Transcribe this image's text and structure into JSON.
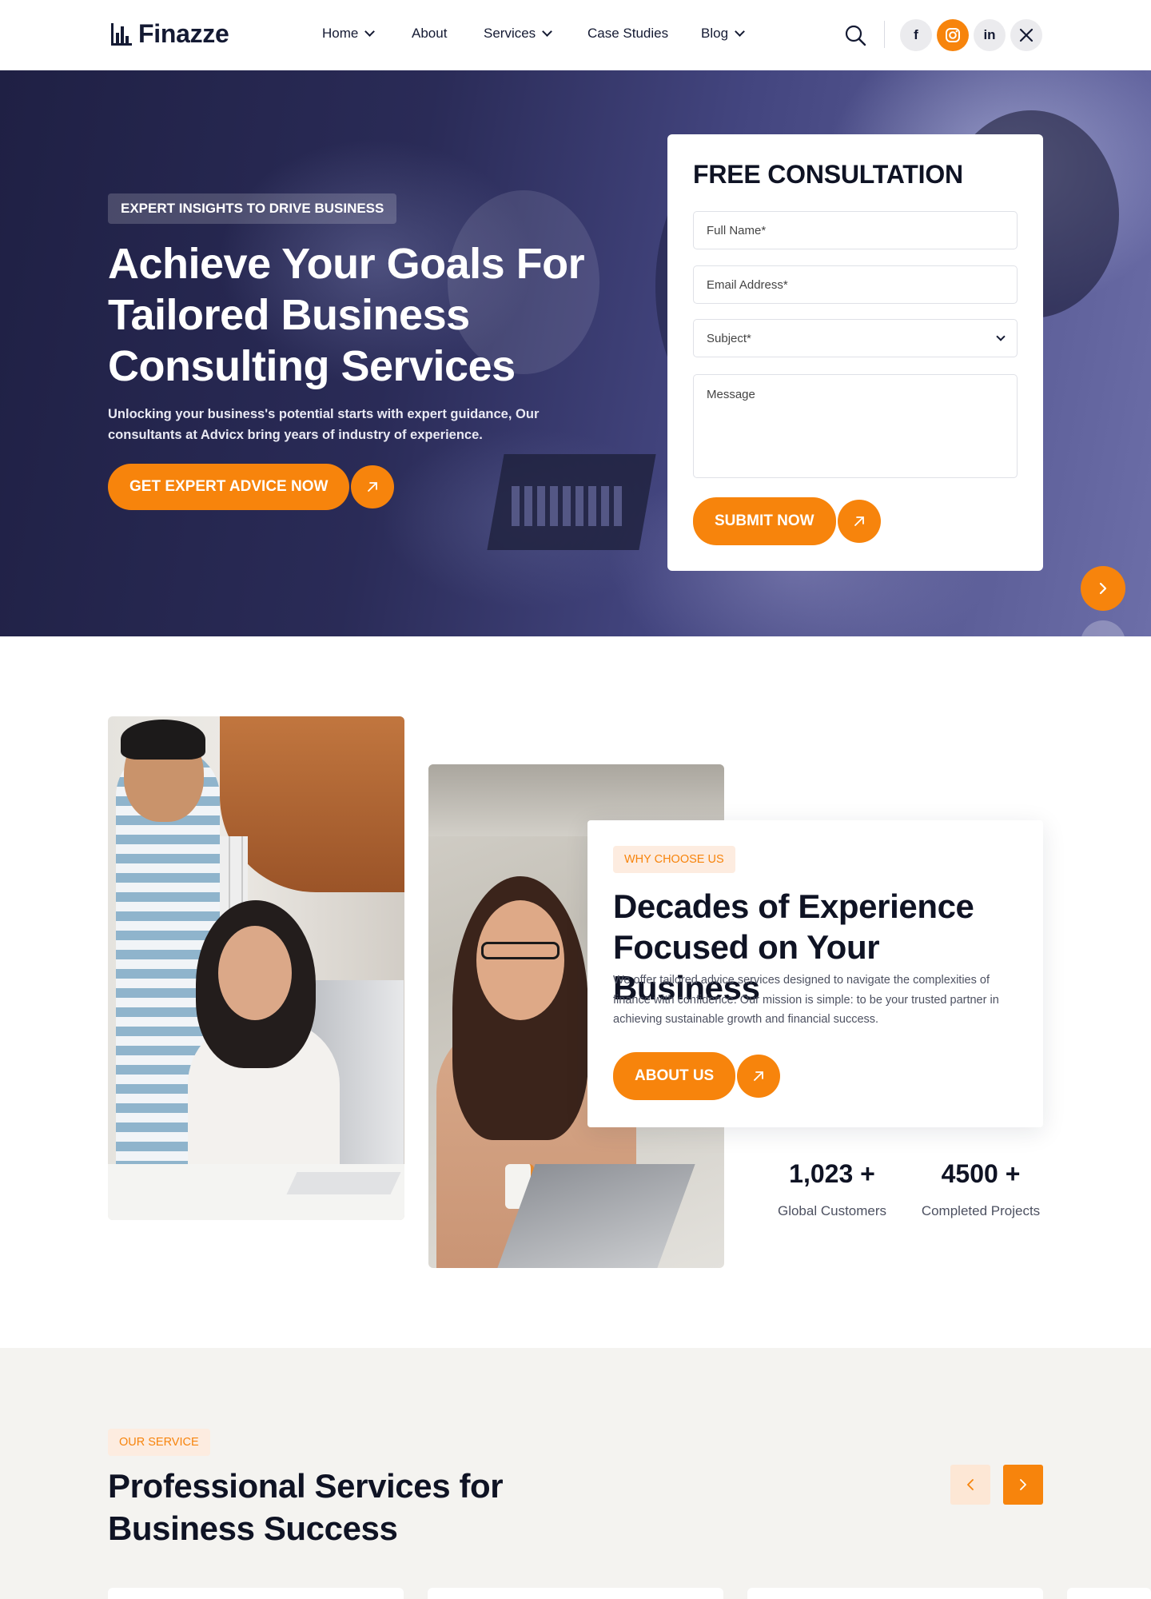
{
  "brand": {
    "name": "Finazze",
    "accent": "#f7840c",
    "dark": "#141a33"
  },
  "nav": {
    "items": [
      {
        "label": "Home",
        "has_dropdown": true
      },
      {
        "label": "About",
        "has_dropdown": false
      },
      {
        "label": "Services",
        "has_dropdown": true
      },
      {
        "label": "Case Studies",
        "has_dropdown": false
      },
      {
        "label": "Blog",
        "has_dropdown": true
      }
    ]
  },
  "header": {
    "icons": [
      "search-icon",
      "facebook-icon",
      "instagram-icon",
      "linkedin-icon",
      "x-icon"
    ],
    "social": {
      "facebook": "f",
      "linkedin": "in",
      "x": "𝕏"
    }
  },
  "hero": {
    "tag": "EXPERT INSIGHTS TO DRIVE BUSINESS",
    "title": "Achieve Your Goals For Tailored Business Consulting Services",
    "subtitle": "Unlocking your business's potential starts with expert guidance, Our consultants at Advicx bring years of industry of experience.",
    "cta_label": "GET EXPERT ADVICE NOW"
  },
  "form": {
    "title": "FREE CONSULTATION",
    "full_name_placeholder": "Full Name*",
    "email_placeholder": "Email Address*",
    "subject_placeholder": "Subject*",
    "message_placeholder": "Message",
    "submit_label": "SUBMIT NOW"
  },
  "about": {
    "badge": "WHY CHOOSE US",
    "title": "Decades of Experience Focused on Your Business",
    "text": "We offer tailored advice services designed to navigate the complexities of finance with confidence. Our mission is simple: to be your trusted partner in achieving sustainable growth and financial success.",
    "cta_label": "ABOUT US",
    "stats": [
      {
        "value": "1,023 +",
        "label": "Global Customers"
      },
      {
        "value": "4500 +",
        "label": "Completed Projects"
      }
    ]
  },
  "services": {
    "badge": "OUR SERVICE",
    "title": "Professional Services for Business Success"
  }
}
